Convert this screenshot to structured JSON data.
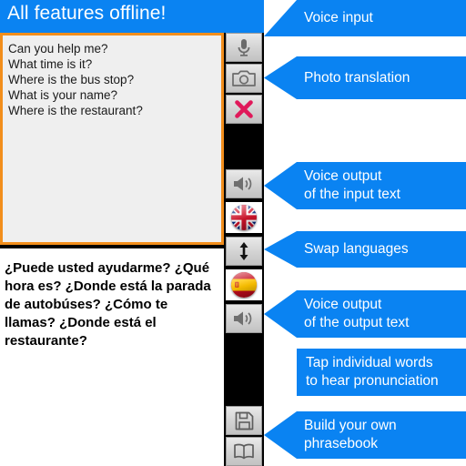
{
  "app": {
    "title": "All features offline!",
    "input_text": "Can you help me?\nWhat time is it?\nWhere is the bus stop?\nWhat is your name?\nWhere is the restaurant?",
    "output_text": "¿Puede usted ayudarme? ¿Qué hora es? ¿Donde está la parada de autobúses? ¿Cómo te llamas? ¿Donde está el restaurante?",
    "accent_blue": "#0a83f2",
    "focus_orange": "#f28e1c",
    "column_background": "#000000"
  },
  "buttons": [
    {
      "name": "microphone-button",
      "icon": "microphone-icon",
      "label": "Voice input"
    },
    {
      "name": "camera-button",
      "icon": "camera-icon",
      "label": "Photo translation"
    },
    {
      "name": "clear-button",
      "icon": "red-x-icon",
      "label": "Clear text"
    },
    {
      "name": "speak-input-button",
      "icon": "speaker-icon",
      "label": "Voice output of the input text"
    },
    {
      "name": "source-language-button",
      "icon": "uk-flag-icon",
      "label": "English"
    },
    {
      "name": "swap-languages-button",
      "icon": "up-down-arrow-icon",
      "label": "Swap languages"
    },
    {
      "name": "target-language-button",
      "icon": "spain-flag-icon",
      "label": "Spanish"
    },
    {
      "name": "speak-output-button",
      "icon": "speaker-icon",
      "label": "Voice output of the output text"
    },
    {
      "name": "save-phrase-button",
      "icon": "floppy-disk-icon",
      "label": "Save phrase"
    },
    {
      "name": "phrasebook-button",
      "icon": "open-book-icon",
      "label": "Phrasebook"
    }
  ],
  "callouts": [
    {
      "name": "callout-voice-input",
      "text": "Voice input",
      "arrow": "flat-top"
    },
    {
      "name": "callout-photo-translation",
      "text": "Photo translation",
      "arrow": "point"
    },
    {
      "name": "callout-voice-output-input-text",
      "text": "Voice output\nof the input text",
      "arrow": "point"
    },
    {
      "name": "callout-swap-languages",
      "text": "Swap languages",
      "arrow": "point"
    },
    {
      "name": "callout-voice-output-output-text",
      "text": "Voice output\nof the output text",
      "arrow": "point"
    },
    {
      "name": "callout-tap-words",
      "text": "Tap individual words\nto hear pronunciation",
      "arrow": "none"
    },
    {
      "name": "callout-build-phrasebook",
      "text": "Build your own\nphrasebook",
      "arrow": "point"
    }
  ]
}
